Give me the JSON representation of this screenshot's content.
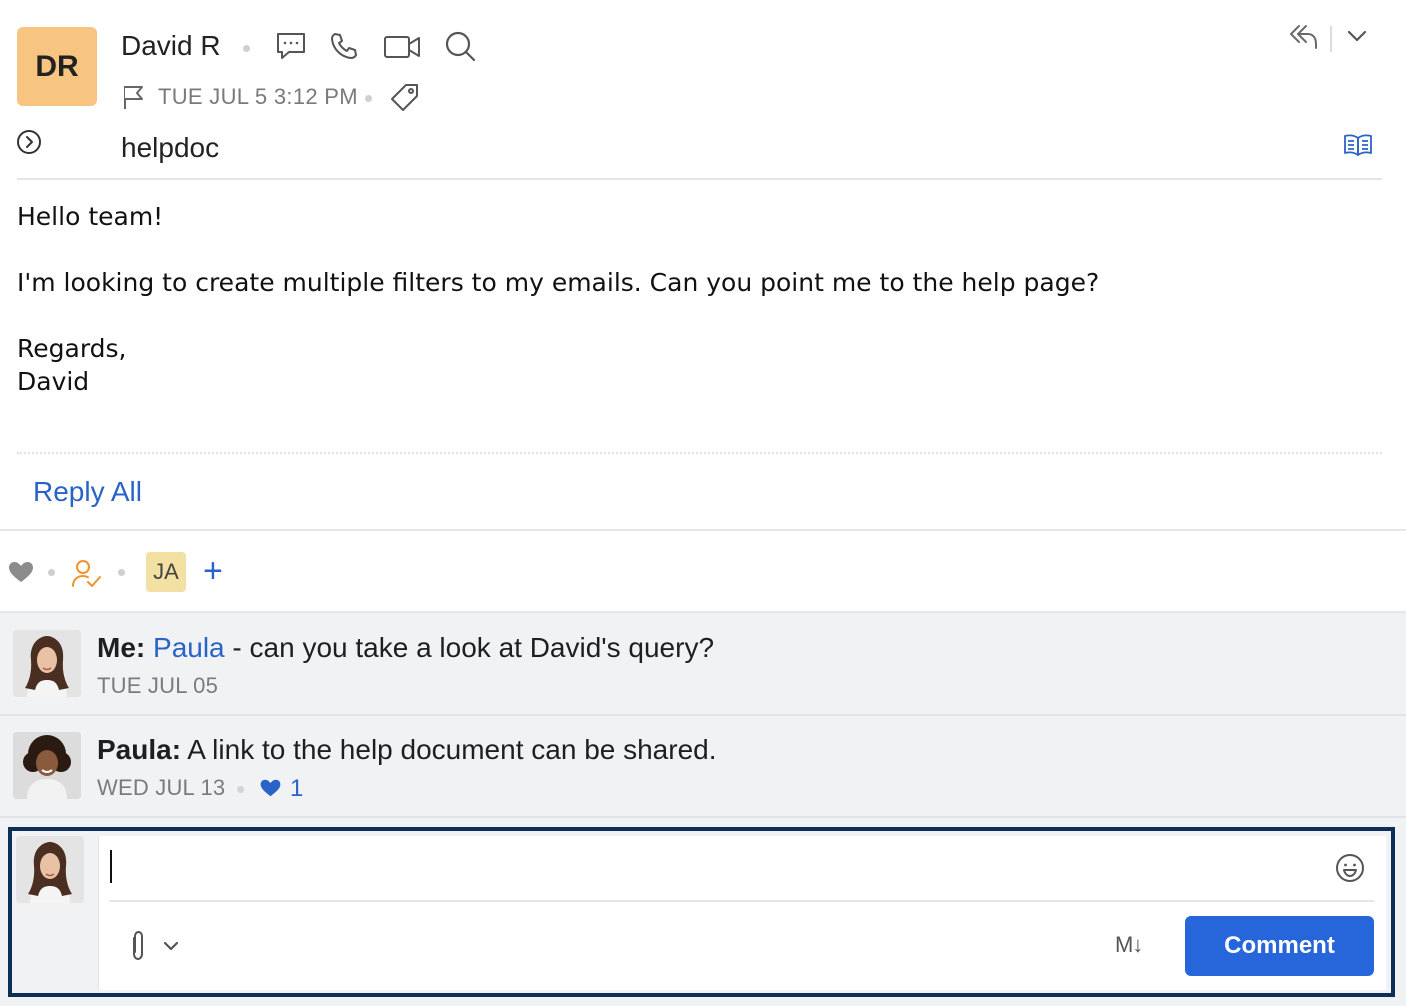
{
  "sender": {
    "initials": "DR",
    "name": "David R",
    "initials_color": "#f7c57f"
  },
  "meta": {
    "date": "TUE JUL 5 3:12 PM",
    "subject": "helpdoc"
  },
  "icons": {
    "chat": "chat-icon",
    "call": "phone-icon",
    "video": "video-icon",
    "search": "search-icon",
    "reply_all_top": "reply-all-icon",
    "more": "chevron-down-icon",
    "flag": "flag-icon",
    "tag": "tag-icon",
    "expand": "expand-circle-icon",
    "reader": "book-icon"
  },
  "body": {
    "greeting": "Hello team!",
    "message": "I'm looking to create multiple filters to my emails. Can you point me to the help page?",
    "closing": "Regards,",
    "signature": "David"
  },
  "actions": {
    "reply_all": "Reply All"
  },
  "reactions": {
    "assignee_initials": "JA",
    "add_label": "+"
  },
  "comments": [
    {
      "author": "Me:",
      "mention": "Paula",
      "text": " - can you take a look at David's query?",
      "date": "TUE JUL 05"
    },
    {
      "author": "Paula:",
      "text": "A link to the help document can be shared.",
      "date": "WED JUL 13",
      "likes": "1"
    }
  ],
  "composer": {
    "value": "",
    "placeholder": "",
    "markdown_label": "M↓",
    "submit_label": "Comment"
  },
  "colors": {
    "accent": "#2a63c7",
    "button": "#2765db",
    "focus_border": "#0d2e57"
  }
}
